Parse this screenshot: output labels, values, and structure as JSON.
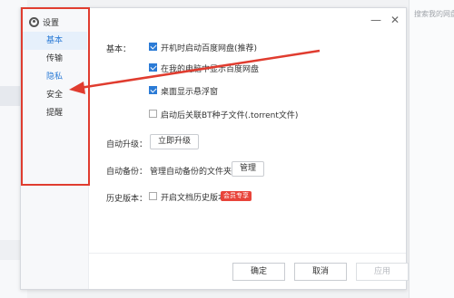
{
  "background": {
    "search_placeholder": "搜索我的网盘"
  },
  "dialog": {
    "title": "设置",
    "controls": {
      "minimize": "—",
      "close": "✕"
    },
    "sidebar": {
      "items": [
        {
          "label": "基本",
          "state": "active"
        },
        {
          "label": "传输",
          "state": "normal"
        },
        {
          "label": "隐私",
          "state": "highlighted"
        },
        {
          "label": "安全",
          "state": "normal"
        },
        {
          "label": "提醒",
          "state": "normal"
        }
      ]
    },
    "basic": {
      "label": "基本：",
      "options": [
        {
          "text": "开机时启动百度网盘(推荐)",
          "checked": true
        },
        {
          "text": "在我的电脑中显示百度网盘",
          "checked": true
        },
        {
          "text": "桌面显示悬浮窗",
          "checked": true
        },
        {
          "text": "启动后关联BT种子文件(.torrent文件)",
          "checked": false
        }
      ]
    },
    "auto_upgrade": {
      "label": "自动升级：",
      "button": "立即升级"
    },
    "auto_backup": {
      "label": "自动备份：",
      "text": "管理自动备份的文件夹",
      "button": "管理"
    },
    "history": {
      "label": "历史版本：",
      "option": "开启文档历史版本",
      "checked": false,
      "badge": "会员专享"
    },
    "footer": {
      "ok": "确定",
      "cancel": "取消",
      "apply": "应用"
    }
  },
  "annotation": {
    "color": "#e03c2f"
  },
  "colors": {
    "accent": "#2b7bd6",
    "badge": "#e8443a"
  }
}
